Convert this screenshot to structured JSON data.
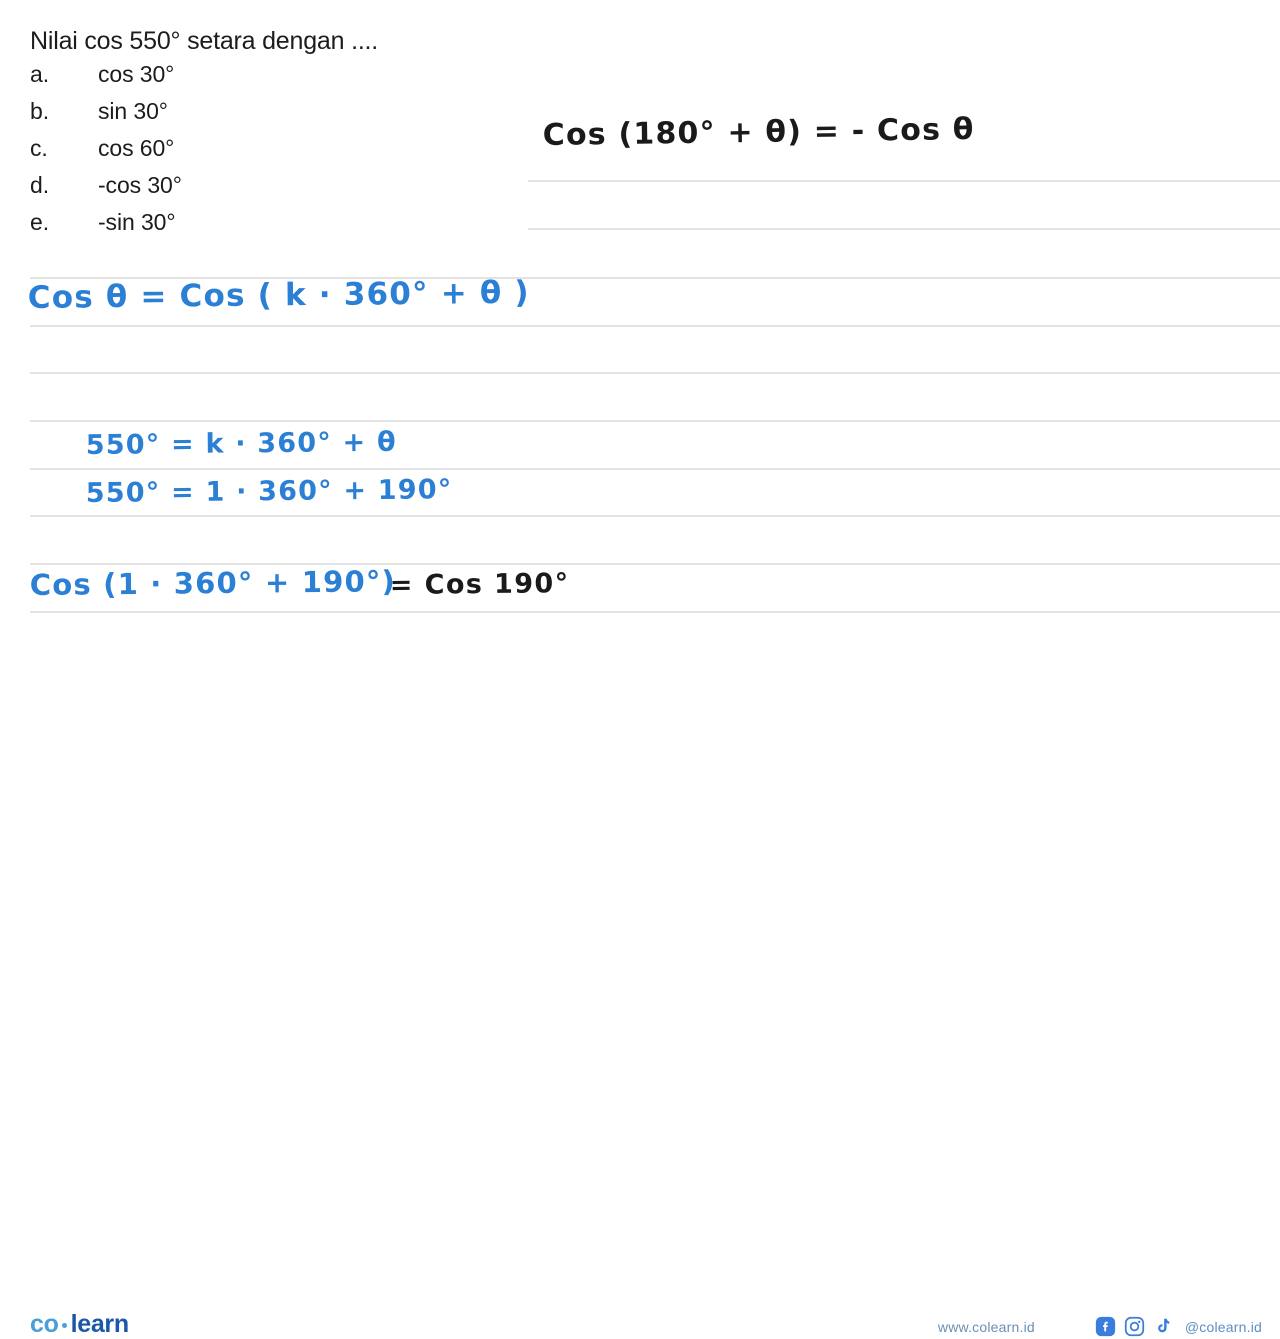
{
  "question": {
    "title": "Nilai cos 550° setara dengan ....",
    "options": [
      {
        "letter": "a.",
        "text": "cos 30°"
      },
      {
        "letter": "b.",
        "text": "sin 30°"
      },
      {
        "letter": "c.",
        "text": "cos 60°"
      },
      {
        "letter": "d.",
        "text": "-cos 30°"
      },
      {
        "letter": "e.",
        "text": "-sin 30°"
      }
    ]
  },
  "handwriting": {
    "identity_rule": "Cos (180° + θ)  =  - Cos θ",
    "periodicity_rule": "Cos θ =  Cos ( k · 360° + θ )",
    "decompose_general": "550°  =  k · 360° + θ",
    "decompose_solved": "550°  =  1 · 360° + 190°",
    "final_left": "Cos (1 · 360° + 190°)",
    "final_right": "=  Cos 190°",
    "ink_blue": "#2b7fd4",
    "ink_black": "#1a1a1a"
  },
  "paper": {
    "rule_color": "#e3e3e3",
    "background": "#ffffff"
  },
  "footer": {
    "logo_first": "co",
    "logo_second": "learn",
    "url": "www.colearn.id",
    "handle": "@colearn.id",
    "logo_color_first": "#4a9fd8",
    "logo_color_second": "#1b57a8",
    "socials": [
      {
        "name": "facebook-icon"
      },
      {
        "name": "instagram-icon"
      },
      {
        "name": "tiktok-icon"
      }
    ]
  }
}
